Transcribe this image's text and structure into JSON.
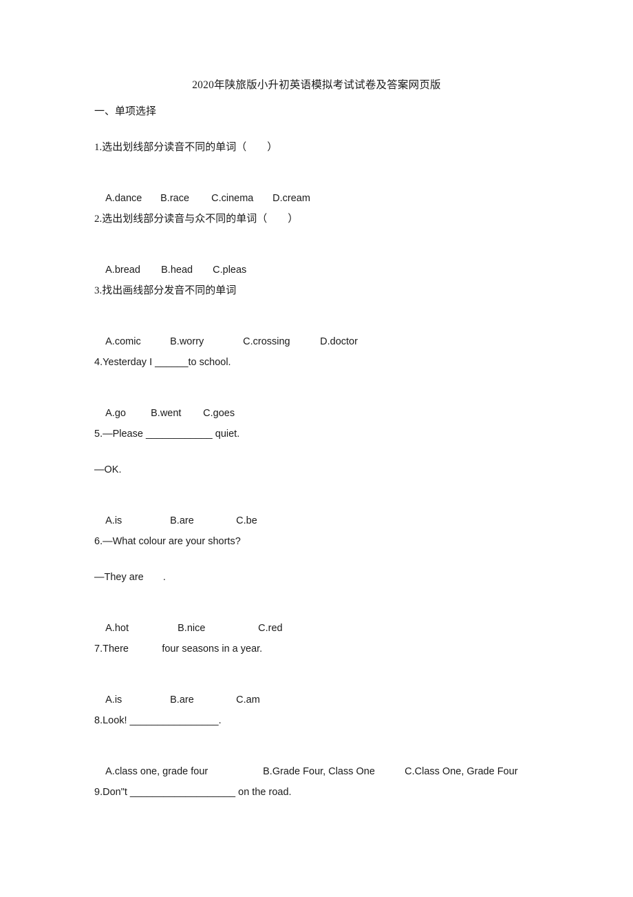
{
  "document": {
    "title": "2020年陕旅版小升初英语模拟考试试卷及答案网页版",
    "section_heading": "一、单项选择",
    "background_color": "#ffffff",
    "text_color": "#1a1a1a"
  },
  "questions": [
    {
      "number": "1",
      "stem": "1.选出划线部分读音不同的单词（        ）",
      "options": [
        {
          "label": "A.dance"
        },
        {
          "label": "B.race"
        },
        {
          "label": "C.cinema"
        },
        {
          "label": "D.cream"
        }
      ]
    },
    {
      "number": "2",
      "stem": "2.选出划线部分读音与众不同的单词（        ）",
      "options": [
        {
          "label": "A.bread"
        },
        {
          "label": "B.head"
        },
        {
          "label": "C.pleas"
        }
      ]
    },
    {
      "number": "3",
      "stem": "3.找出画线部分发音不同的单词",
      "options": [
        {
          "label": "A.comic"
        },
        {
          "label": "B.worry"
        },
        {
          "label": "C.crossing"
        },
        {
          "label": "D.doctor"
        }
      ]
    },
    {
      "number": "4",
      "stem": "4.Yesterday I ______to school.",
      "options": [
        {
          "label": "A.go"
        },
        {
          "label": "B.went"
        },
        {
          "label": "C.goes"
        }
      ]
    },
    {
      "number": "5",
      "stem": "5.—Please ____________ quiet.",
      "stem_line2": "—OK.",
      "options": [
        {
          "label": "A.is"
        },
        {
          "label": "B.are"
        },
        {
          "label": "C.be"
        }
      ]
    },
    {
      "number": "6",
      "stem": "6.—What colour are your shorts?",
      "stem_line2": "—They are       .",
      "options": [
        {
          "label": "A.hot"
        },
        {
          "label": "B.nice"
        },
        {
          "label": "C.red"
        }
      ]
    },
    {
      "number": "7",
      "stem": "7.There            four seasons in a year.",
      "options": [
        {
          "label": "A.is"
        },
        {
          "label": "B.are"
        },
        {
          "label": "C.am"
        }
      ]
    },
    {
      "number": "8",
      "stem": "8.Look! ________________.",
      "options": [
        {
          "label": "A.class one, grade four"
        },
        {
          "label": "B.Grade Four, Class One"
        },
        {
          "label": "C.Class One, Grade Four"
        }
      ]
    },
    {
      "number": "9",
      "stem": "9.Don\"t ___________________ on the road."
    }
  ]
}
